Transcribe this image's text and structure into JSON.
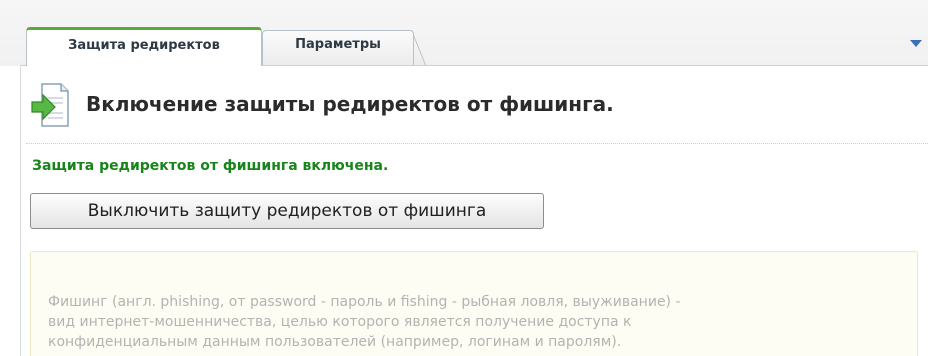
{
  "tabs": [
    {
      "label": "Защита редиректов",
      "active": true
    },
    {
      "label": "Параметры",
      "active": false
    }
  ],
  "header": {
    "title": "Включение защиты редиректов от фишинга.",
    "icon": "page-arrow-icon"
  },
  "status": {
    "text": "Защита редиректов от фишинга включена.",
    "color": "#17851a"
  },
  "action": {
    "button_label": "Выключить защиту редиректов от фишинга"
  },
  "info": {
    "text": "Фишинг (англ. phishing, от password - пароль и fishing - рыбная ловля, выуживание) -\nвид интернет-мошенничества, целью которого является получение доступа к\nконфиденциальным данным пользователей (например, логинам и паролям)."
  },
  "colors": {
    "accent_tab": "#59a83a",
    "menu_arrow": "#3a6fb7"
  }
}
